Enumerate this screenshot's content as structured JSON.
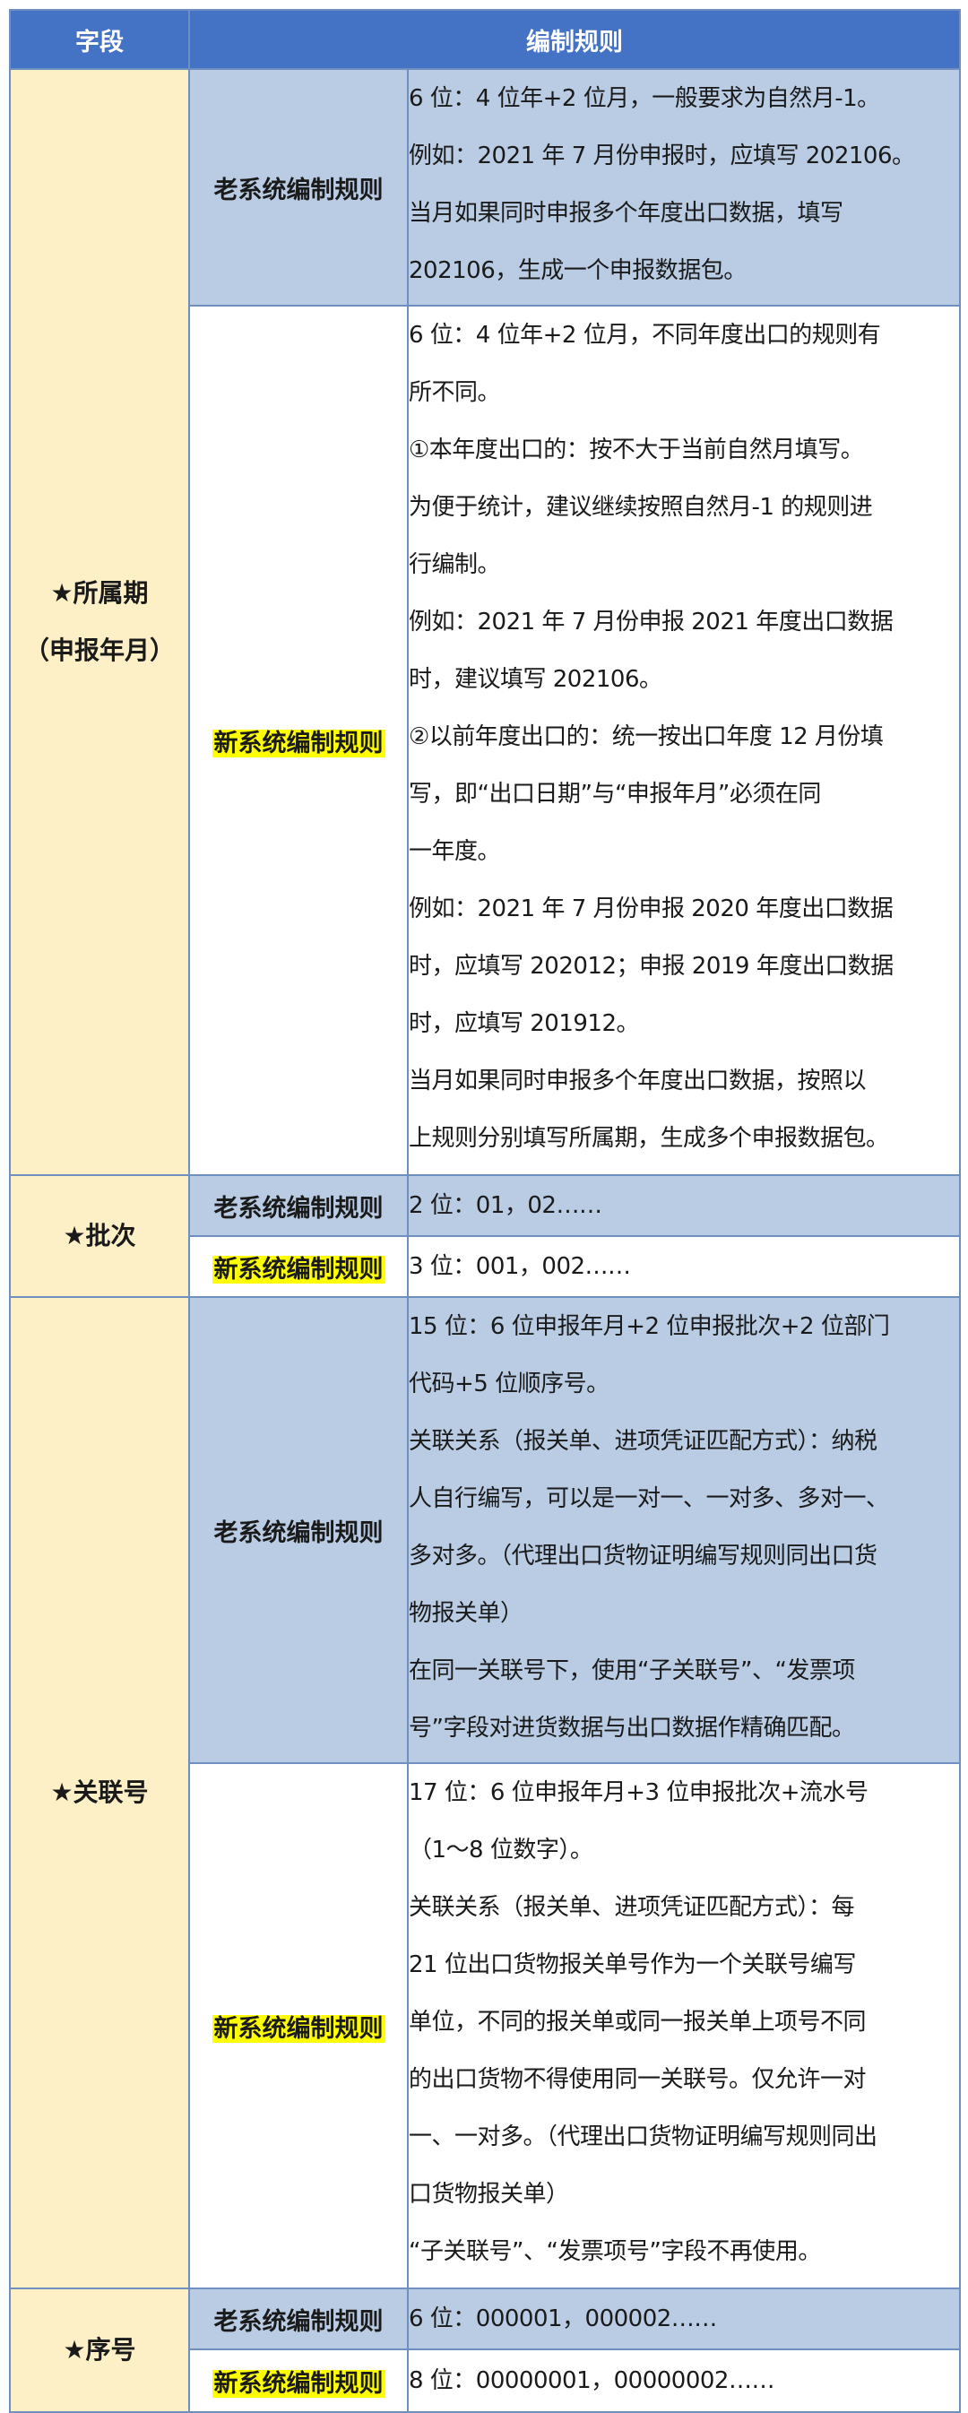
{
  "header": {
    "col_field": "字段",
    "col_rules": "编制规则"
  },
  "old_label": "老系统编制规则",
  "new_label": "新系统编制规则",
  "period": {
    "field_line1": "★所属期",
    "field_line2": "（申报年月）",
    "old": [
      "6 位：4 位年+2 位月，一般要求为自然月-1。",
      "例如：2021 年 7 月份申报时，应填写 202106。",
      "当月如果同时申报多个年度出口数据，填写",
      "202106，生成一个申报数据包。"
    ],
    "new": [
      "6 位：4 位年+2 位月，不同年度出口的规则有",
      "所不同。",
      "①本年度出口的：按不大于当前自然月填写。",
      "为便于统计，建议继续按照自然月-1 的规则进",
      "行编制。",
      "例如：2021 年 7 月份申报 2021 年度出口数据",
      "时，建议填写 202106。",
      "②以前年度出口的：统一按出口年度 12 月份填",
      "写，即“出口日期”与“申报年月”必须在同",
      "一年度。",
      "例如：2021 年 7 月份申报 2020 年度出口数据",
      "时，应填写 202012；申报 2019 年度出口数据",
      "时，应填写 201912。",
      "当月如果同时申报多个年度出口数据，按照以",
      "上规则分别填写所属期，生成多个申报数据包。"
    ]
  },
  "batch": {
    "field": "★批次",
    "old": "2 位：01，02……",
    "new": "3 位：001，002……"
  },
  "link": {
    "field": "★关联号",
    "old": [
      "15 位：6 位申报年月+2 位申报批次+2 位部门",
      "代码+5 位顺序号。",
      "关联关系（报关单、进项凭证匹配方式）：纳税",
      "人自行编写，可以是一对一、一对多、多对一、",
      "多对多。（代理出口货物证明编写规则同出口货",
      "物报关单）",
      "在同一关联号下，使用“子关联号”、“发票项",
      "号”字段对进货数据与出口数据作精确匹配。"
    ],
    "new": [
      "17 位：6 位申报年月+3 位申报批次+流水号",
      "（1～8 位数字）。",
      "关联关系（报关单、进项凭证匹配方式）：每",
      "21 位出口货物报关单号作为一个关联号编写",
      "单位，不同的报关单或同一报关单上项号不同",
      "的出口货物不得使用同一关联号。仅允许一对",
      "一、一对多。（代理出口货物证明编写规则同出",
      "口货物报关单）",
      "“子关联号”、“发票项号”字段不再使用。"
    ]
  },
  "seq": {
    "field": "★序号",
    "old": "6 位：000001，000002……",
    "new": "8 位：00000001，00000002……"
  }
}
